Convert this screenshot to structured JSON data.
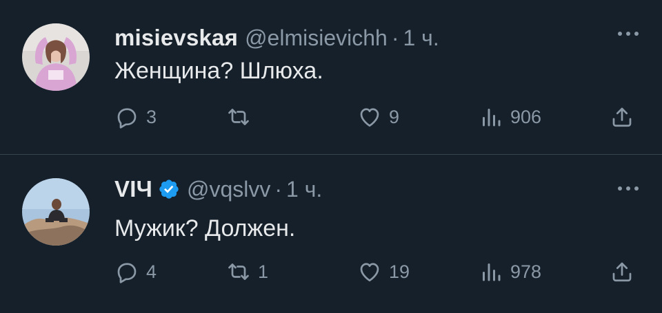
{
  "tweets": [
    {
      "name": "misievskaя",
      "handle": "@elmisievichh",
      "separator": "·",
      "time": "1 ч.",
      "verified": false,
      "text": "Женщина? Шлюха.",
      "replies": "3",
      "retweets": "",
      "likes": "9",
      "views": "906",
      "avatar": "photo of a woman in pink sweater"
    },
    {
      "name": "VIЧ",
      "handle": "@vqslvv",
      "separator": "·",
      "time": "1 ч.",
      "verified": true,
      "text": "Мужик? Должен.",
      "replies": "4",
      "retweets": "1",
      "likes": "19",
      "views": "978",
      "avatar": "photo of a man sitting on rocks"
    }
  ],
  "icons": {
    "reply": "reply-icon",
    "retweet": "retweet-icon",
    "like": "heart-icon",
    "views": "views-icon",
    "share": "share-icon",
    "more": "more-icon",
    "verified": "verified-badge-icon"
  },
  "colors": {
    "background": "#15202b",
    "text": "#e7e9ea",
    "secondary": "#8b98a5",
    "divider": "#38444d",
    "verified": "#1d9bf0"
  }
}
